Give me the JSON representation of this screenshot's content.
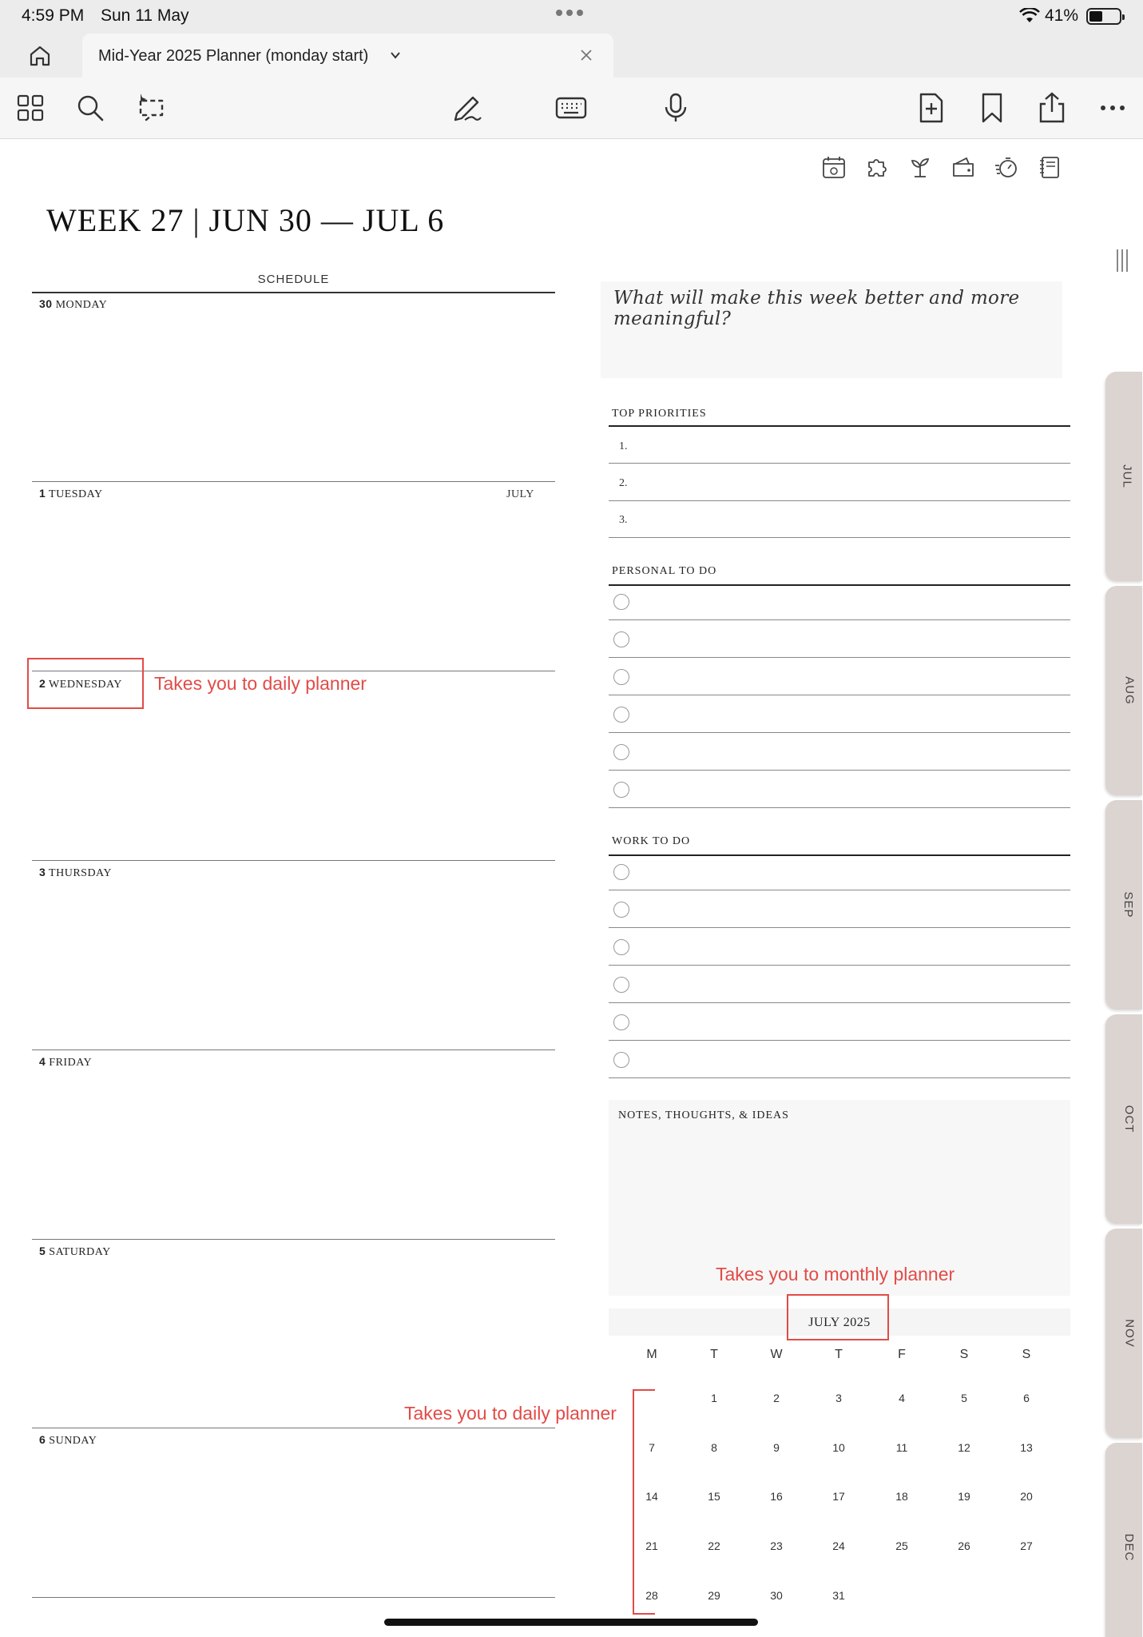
{
  "status_bar": {
    "time": "4:59 PM",
    "date": "Sun 11 May",
    "battery": "41%"
  },
  "tab": {
    "title": "Mid-Year 2025 Planner (monday start)"
  },
  "toolbar": {
    "icons": [
      "grid-icon",
      "search-icon",
      "lasso-icon",
      "pen-icon",
      "keyboard-icon",
      "microphone-icon",
      "add-page-icon",
      "bookmark-icon",
      "share-icon",
      "more-icon"
    ]
  },
  "page_icons": [
    "calendar-icon",
    "puzzle-icon",
    "plant-icon",
    "wallet-icon",
    "timer-icon",
    "notebook-icon"
  ],
  "week": {
    "title_prefix": "WEEK 27",
    "title_separator": "|",
    "title_range": "JUN 30 — JUL 6"
  },
  "schedule": {
    "header": "SCHEDULE",
    "month_marker": "JULY",
    "days": [
      {
        "num": "30",
        "name": "MONDAY"
      },
      {
        "num": "1",
        "name": "TUESDAY"
      },
      {
        "num": "2",
        "name": "WEDNESDAY"
      },
      {
        "num": "3",
        "name": "THURSDAY"
      },
      {
        "num": "4",
        "name": "FRIDAY"
      },
      {
        "num": "5",
        "name": "SATURDAY"
      },
      {
        "num": "6",
        "name": "SUNDAY"
      }
    ]
  },
  "reflection": {
    "prompt": "What will make this week better and more meaningful?"
  },
  "priorities": {
    "title": "TOP PRIORITIES",
    "items": [
      "1.",
      "2.",
      "3."
    ]
  },
  "personal_todo": {
    "title": "PERSONAL TO DO"
  },
  "work_todo": {
    "title": "WORK TO DO"
  },
  "notes": {
    "title": "NOTES, THOUGHTS, & IDEAS"
  },
  "calendar": {
    "month": "JULY 2025",
    "weekdays": [
      "M",
      "T",
      "W",
      "T",
      "F",
      "S",
      "S"
    ],
    "weeks": [
      [
        "",
        "1",
        "2",
        "3",
        "4",
        "5",
        "6"
      ],
      [
        "7",
        "8",
        "9",
        "10",
        "11",
        "12",
        "13"
      ],
      [
        "14",
        "15",
        "16",
        "17",
        "18",
        "19",
        "20"
      ],
      [
        "21",
        "22",
        "23",
        "24",
        "25",
        "26",
        "27"
      ],
      [
        "28",
        "29",
        "30",
        "31",
        "",
        "",
        ""
      ]
    ]
  },
  "month_tabs": [
    "JUL",
    "AUG",
    "SEP",
    "OCT",
    "NOV",
    "DEC"
  ],
  "annotations": {
    "day_link": "Takes you to daily planner",
    "month_link": "Takes you to monthly planner",
    "calendar_days_link": "Takes you to daily planner"
  },
  "colors": {
    "annotation": "#e24b47",
    "month_tab": "#dcd4d1"
  }
}
